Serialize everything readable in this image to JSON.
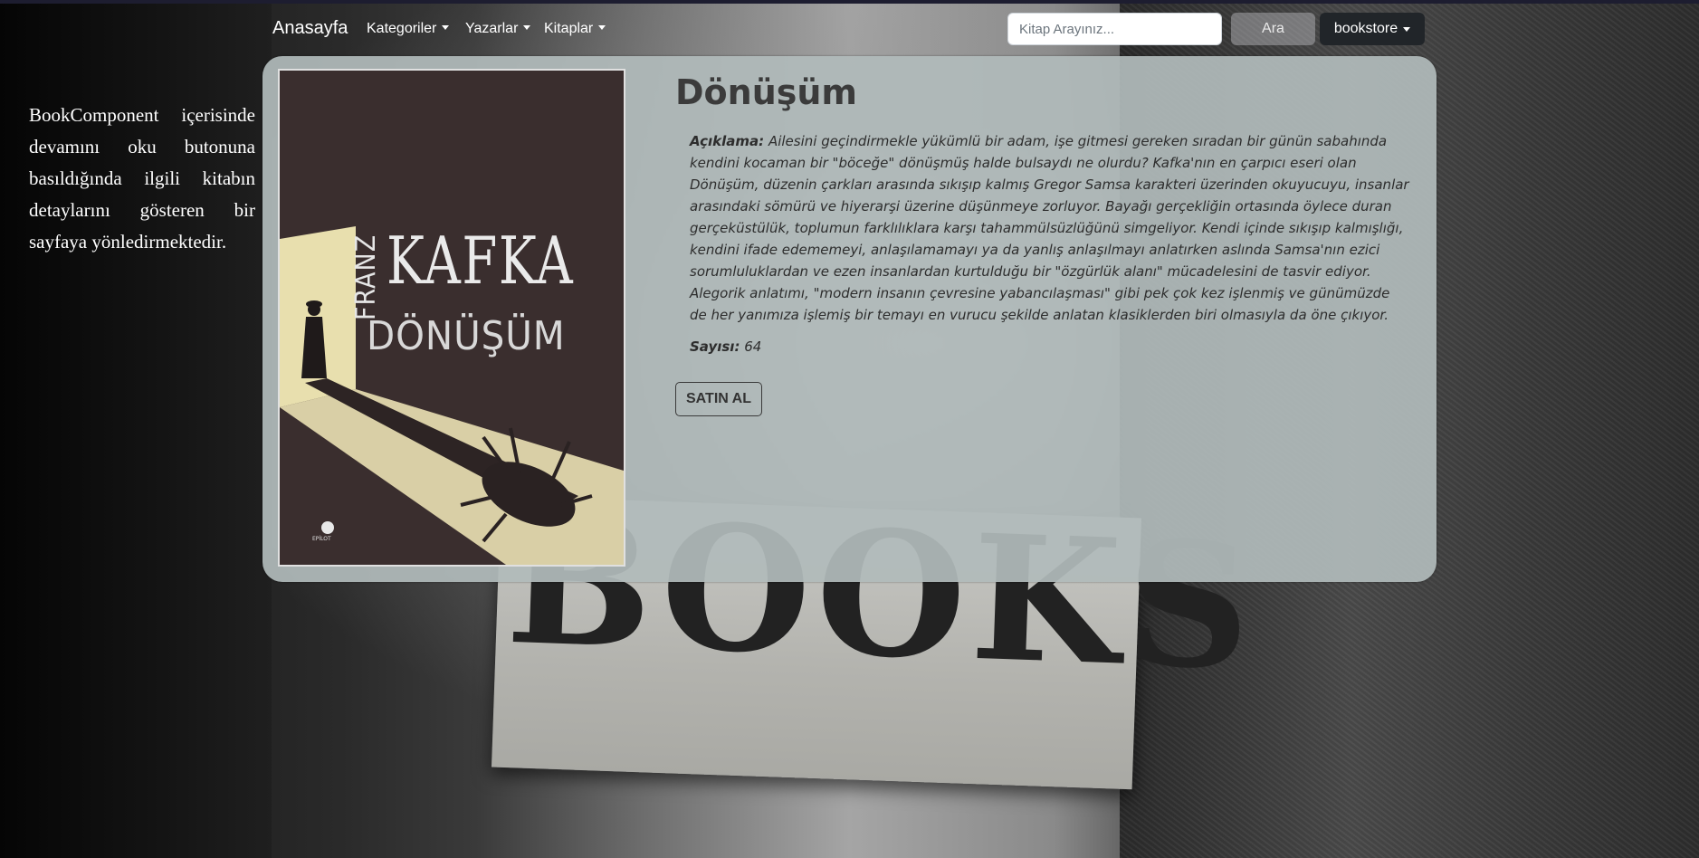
{
  "navbar": {
    "brand": "Anasayfa",
    "items": [
      {
        "label": "Kategoriler"
      },
      {
        "label": "Yazarlar"
      },
      {
        "label": "Kitaplar"
      }
    ],
    "search_placeholder": "Kitap Arayınız...",
    "search_button": "Ara",
    "user_menu": "bookstore"
  },
  "sidebar_note": "BookComponent içerisinde devamını oku butonuna basıldığında ilgili kitabın detaylarını gösteren bir sayfaya yönledirmektedir.",
  "background_sign_text": "BOOKS",
  "book": {
    "title": "Dönüşüm",
    "cover": {
      "author_first": "FRANZ",
      "author_last": "KAFKA",
      "title": "DÖNÜŞÜM",
      "publisher": "EPİLOT"
    },
    "description_label": "Açıklama:",
    "description": "Ailesini geçindirmekle yükümlü bir adam, işe gitmesi gereken sıradan bir günün sabahında kendini kocaman bir \"böceğe\" dönüşmüş halde bulsaydı ne olurdu? Kafka'nın en çarpıcı eseri olan Dönüşüm, düzenin çarkları arasında sıkışıp kalmış Gregor Samsa karakteri üzerinden okuyucuyu, insanlar arasındaki sömürü ve hiyerarşi üzerine düşünmeye zorluyor. Bayağı gerçekliğin ortasında öylece duran gerçeküstülük, toplumun farklılıklara karşı tahammülsüzlüğünü simgeliyor. Kendi içinde sıkışıp kalmışlığı, kendini ifade edememeyi, anlaşılamamayı ya da yanlış anlaşılmayı anlatırken aslında Samsa'nın ezici sorumluluklardan ve ezen insanlardan kurtulduğu bir \"özgürlük alanı\" mücadelesini de tasvir ediyor. Alegorik anlatımı, \"modern insanın çevresine yabancılaşması\" gibi pek çok kez işlenmiş ve günümüzde de her yanımıza işlemiş bir temayı en vurucu şekilde anlatan klasiklerden biri olmasıyla da öne çıkıyor.",
    "pages_label": "Sayısı:",
    "pages": "64",
    "buy_button": "SATIN AL"
  },
  "colors": {
    "card_bg": "#b0baba",
    "dark_button": "#212529",
    "cover_bg": "#3a2e2e",
    "cover_light": "#e8dfae"
  }
}
